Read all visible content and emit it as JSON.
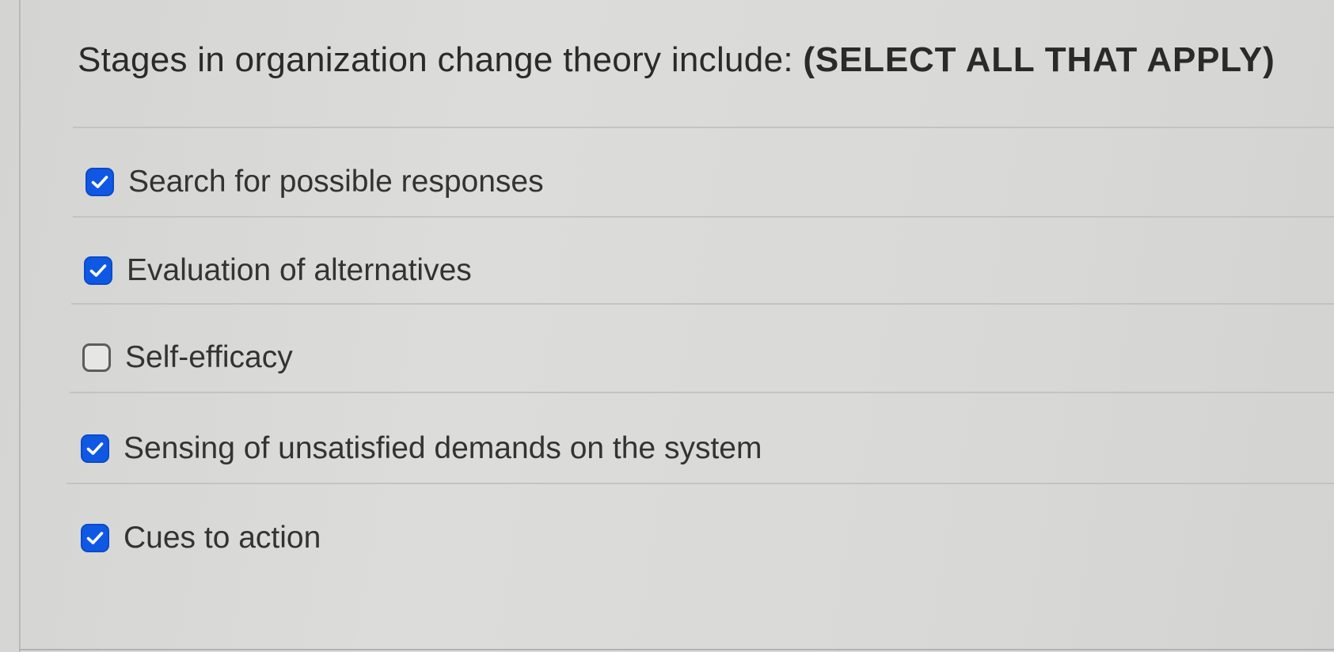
{
  "question": {
    "text": "Stages in organization change theory include:",
    "instruction": "(SELECT ALL THAT APPLY)"
  },
  "options": [
    {
      "label": "Search for possible responses",
      "checked": true
    },
    {
      "label": "Evaluation of alternatives",
      "checked": true
    },
    {
      "label": "Self-efficacy",
      "checked": false
    },
    {
      "label": "Sensing of unsatisfied demands on the system",
      "checked": true
    },
    {
      "label": "Cues to action",
      "checked": true
    }
  ],
  "colors": {
    "checkbox_checked": "#0f58e3",
    "checkbox_unchecked_border": "#5c5c5c",
    "background": "#d9d9d7",
    "text": "#2b2b2b"
  }
}
